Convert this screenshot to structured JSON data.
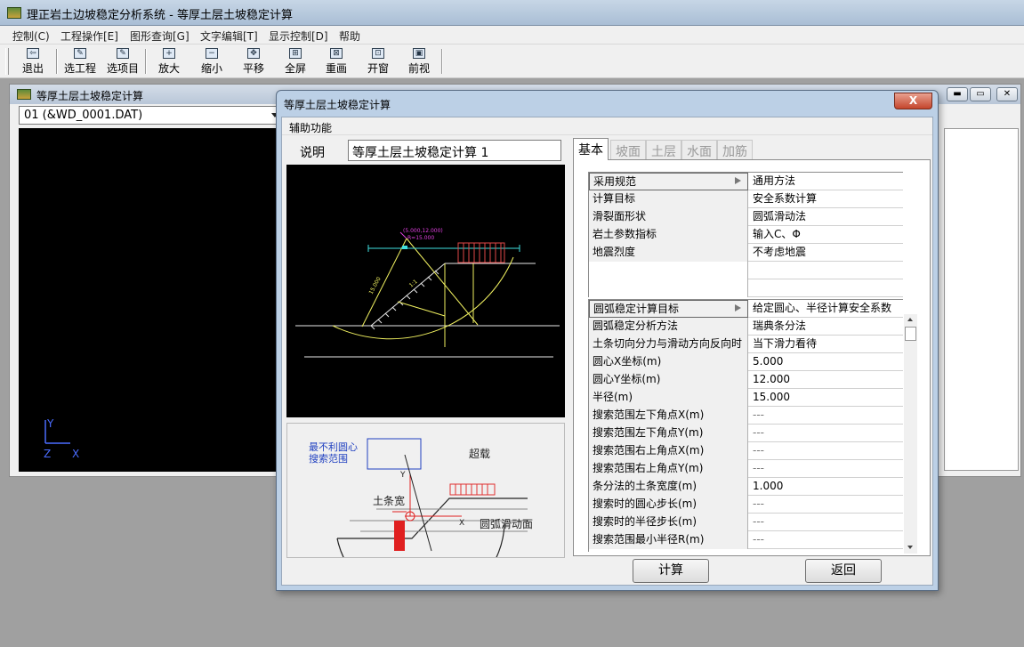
{
  "app": {
    "title": "理正岩土边坡稳定分析系统 - 等厚土层土坡稳定计算"
  },
  "menu": [
    "控制(C)",
    "工程操作[E]",
    "图形查询[G]",
    "文字编辑[T]",
    "显示控制[D]",
    "帮助"
  ],
  "toolbar": [
    {
      "label": "退出",
      "icon": "exit-icon"
    },
    {
      "label": "选工程",
      "icon": "select-project-icon"
    },
    {
      "label": "选项目",
      "icon": "select-item-icon"
    },
    {
      "label": "放大",
      "icon": "zoom-in-icon"
    },
    {
      "label": "缩小",
      "icon": "zoom-out-icon"
    },
    {
      "label": "平移",
      "icon": "pan-icon"
    },
    {
      "label": "全屏",
      "icon": "fullscreen-icon"
    },
    {
      "label": "重画",
      "icon": "redraw-icon"
    },
    {
      "label": "开窗",
      "icon": "window-icon"
    },
    {
      "label": "前视",
      "icon": "front-view-icon"
    }
  ],
  "child_window": {
    "title": "等厚土层土坡稳定计算",
    "file_select": "01  (&WD_0001.DAT)",
    "axis_y": "Y",
    "axis_z": "Z",
    "axis_x": "X"
  },
  "dialog": {
    "title": "等厚土层土坡稳定计算",
    "close": "X",
    "menu": "辅助功能",
    "desc_label": "说明",
    "desc_value": "等厚土层土坡稳定计算 1",
    "tabs": [
      "基本",
      "坡面",
      "土层",
      "水面",
      "加筋"
    ],
    "active_tab": "基本",
    "basic_grid": [
      {
        "key": "采用规范",
        "value": "通用方法"
      },
      {
        "key": "计算目标",
        "value": "安全系数计算"
      },
      {
        "key": "滑裂面形状",
        "value": "圆弧滑动法"
      },
      {
        "key": "岩土参数指标",
        "value": "输入C、Φ"
      },
      {
        "key": "地震烈度",
        "value": "不考虑地震"
      },
      {
        "key": "",
        "value": ""
      },
      {
        "key": "",
        "value": ""
      }
    ],
    "arc_grid": [
      {
        "key": "圆弧稳定计算目标",
        "value": "给定圆心、半径计算安全系数"
      },
      {
        "key": "圆弧稳定分析方法",
        "value": "瑞典条分法"
      },
      {
        "key": "土条切向分力与滑动方向反向时",
        "value": "当下滑力看待"
      },
      {
        "key": "圆心X坐标(m)",
        "value": "5.000"
      },
      {
        "key": "圆心Y坐标(m)",
        "value": "12.000"
      },
      {
        "key": "半径(m)",
        "value": "15.000"
      },
      {
        "key": "搜索范围左下角点X(m)",
        "value": "---"
      },
      {
        "key": "搜索范围左下角点Y(m)",
        "value": "---"
      },
      {
        "key": "搜索范围右上角点X(m)",
        "value": "---"
      },
      {
        "key": "搜索范围右上角点Y(m)",
        "value": "---"
      },
      {
        "key": "条分法的土条宽度(m)",
        "value": "1.000"
      },
      {
        "key": "搜索时的圆心步长(m)",
        "value": "---"
      },
      {
        "key": "搜索时的半径步长(m)",
        "value": "---"
      },
      {
        "key": "搜索范围最小半径R(m)",
        "value": "---"
      }
    ],
    "preview_labels": {
      "center": "(5.000,12.000)",
      "radius_label": "R=15.000",
      "radius_line": "15.000",
      "slope": "1:1"
    },
    "legend": {
      "search_range": "最不利圆心搜索范围",
      "surcharge": "超载",
      "slice_width": "土条宽",
      "arc_surface": "圆弧滑动面",
      "axis_y": "Y",
      "axis_x": "X"
    },
    "calc_button": "计算",
    "back_button": "返回"
  }
}
